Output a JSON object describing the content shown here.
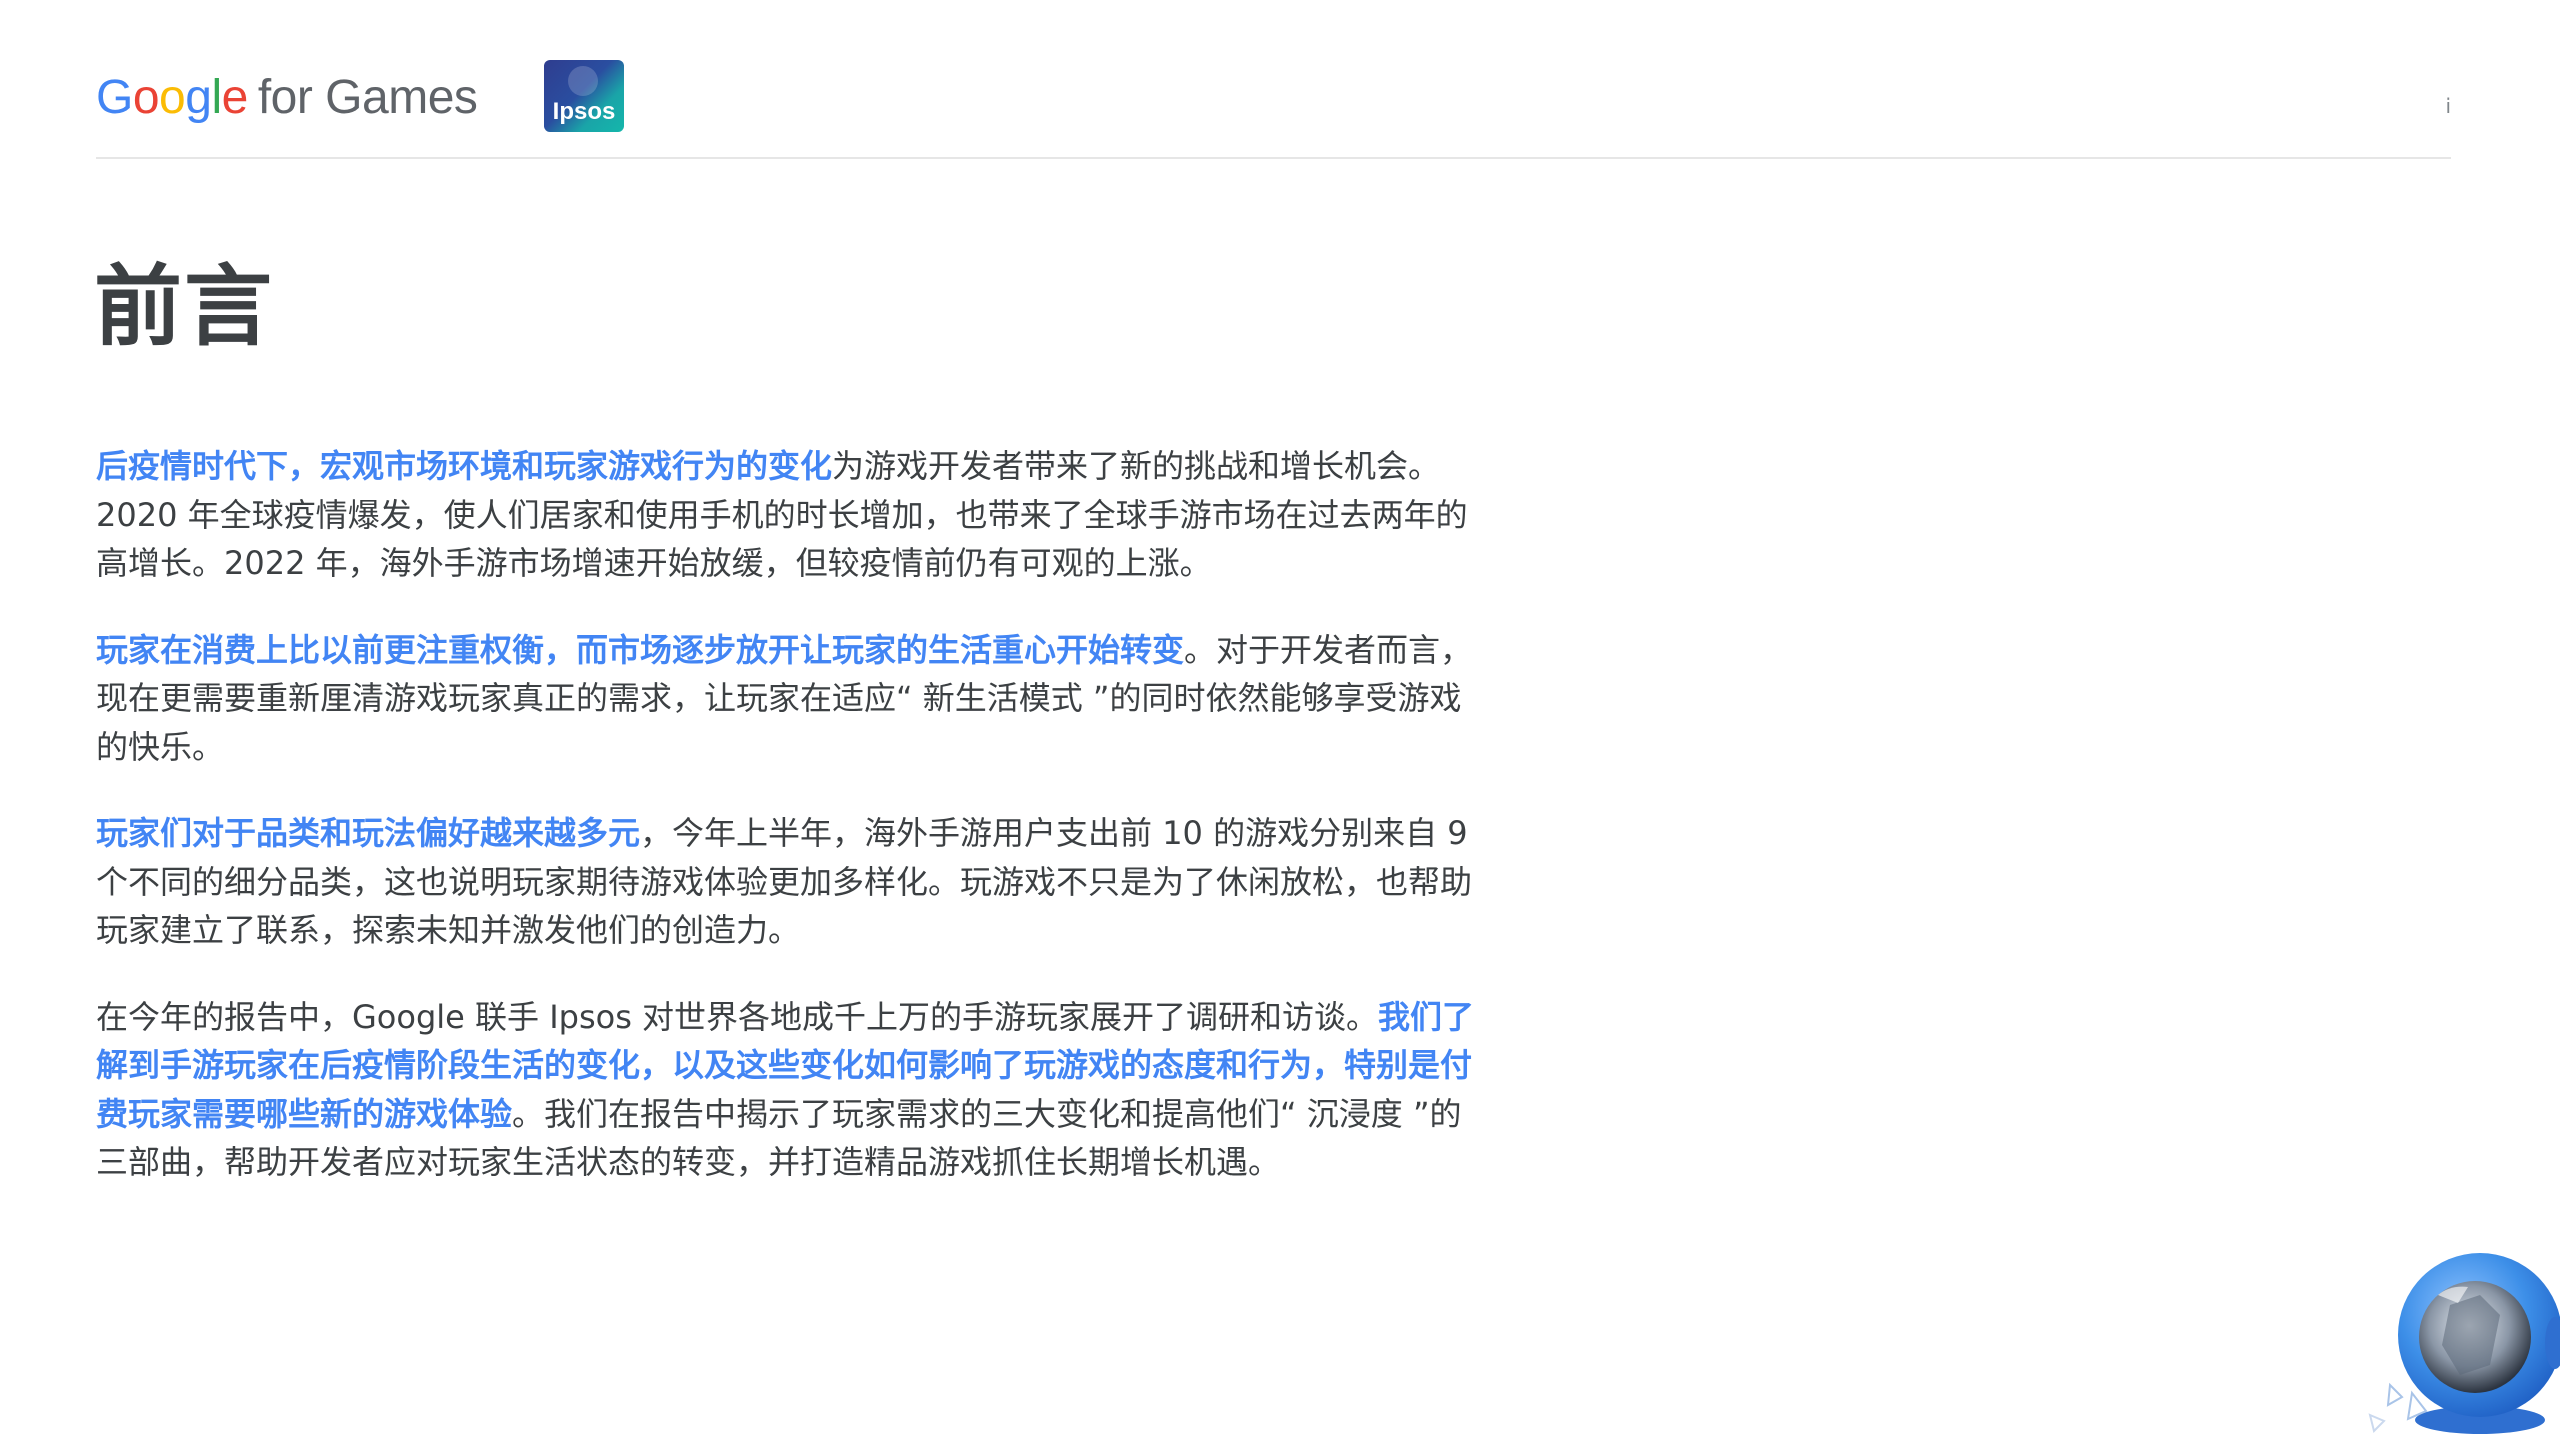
{
  "header": {
    "google_logo": {
      "g1": "G",
      "g2": "o",
      "g3": "o",
      "g4": "g",
      "g5": "l",
      "g6": "e",
      "rest": "for Games"
    },
    "ipsos_logo": "Ipsos",
    "page_mark": "i"
  },
  "title": "前言",
  "paragraphs": [
    {
      "highlight": "后疫情时代下，宏观市场环境和玩家游戏行为的变化",
      "text": "为游戏开发者带来了新的挑战和增长机会。2020 年全球疫情爆发，使人们居家和使用手机的时长增加，也带来了全球手游市场在过去两年的高增长。2022 年，海外手游市场增速开始放缓，但较疫情前仍有可观的上涨。"
    },
    {
      "highlight": "玩家在消费上比以前更注重权衡，而市场逐步放开让玩家的生活重心开始转变",
      "text": "。对于开发者而言，现在更需要重新厘清游戏玩家真正的需求，让玩家在适应“ 新生活模式 ”的同时依然能够享受游戏的快乐。"
    },
    {
      "highlight": "玩家们对于品类和玩法偏好越来越多元",
      "text": "，今年上半年，海外手游用户支出前 10 的游戏分别来自 9 个不同的细分品类，这也说明玩家期待游戏体验更加多样化。玩游戏不只是为了休闲放松，也帮助玩家建立了联系，探索未知并激发他们的创造力。"
    },
    {
      "text_before": "在今年的报告中，Google 联手 Ipsos 对世界各地成千上万的手游玩家展开了调研和访谈。",
      "highlight": "我们了解到手游玩家在后疫情阶段生活的变化，以及这些变化如何影响了玩游戏的态度和行为，特别是付费玩家需要哪些新的游戏体验",
      "text": "。我们在报告中揭示了玩家需求的三大变化和提高他们“ 沉浸度 ”的三部曲，帮助开发者应对玩家生活状态的转变，并打造精品游戏抓住长期增长机遇。"
    }
  ],
  "colors": {
    "accent_blue": "#4285f4",
    "body_text": "#3c4043",
    "divider": "#e6e6e6"
  },
  "icons": {
    "helmet": "astronaut-helmet-icon"
  }
}
